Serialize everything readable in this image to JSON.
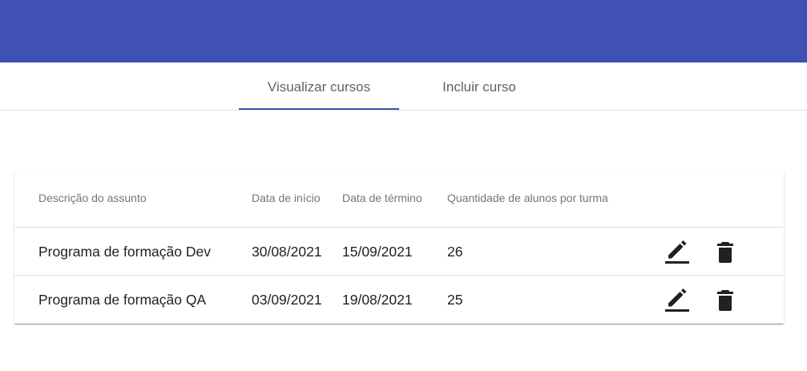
{
  "colors": {
    "primary": "#3f51b5",
    "text": "#212121",
    "muted": "#757575",
    "divider": "#e0e0e0"
  },
  "tabs": [
    {
      "label": "Visualizar cursos",
      "active": true
    },
    {
      "label": "Incluir curso",
      "active": false
    }
  ],
  "table": {
    "headers": [
      "Descrição do assunto",
      "Data de início",
      "Data de término",
      "Quantidade de alunos por turma"
    ],
    "rows": [
      {
        "descricao": "Programa de formação Dev",
        "inicio": "30/08/2021",
        "termino": "15/09/2021",
        "quantidade": "26",
        "edit_icon": "edit-icon",
        "delete_icon": "delete-icon"
      },
      {
        "descricao": "Programa de formação QA",
        "inicio": "03/09/2021",
        "termino": "19/08/2021",
        "quantidade": "25",
        "edit_icon": "edit-icon",
        "delete_icon": "delete-icon"
      }
    ]
  }
}
